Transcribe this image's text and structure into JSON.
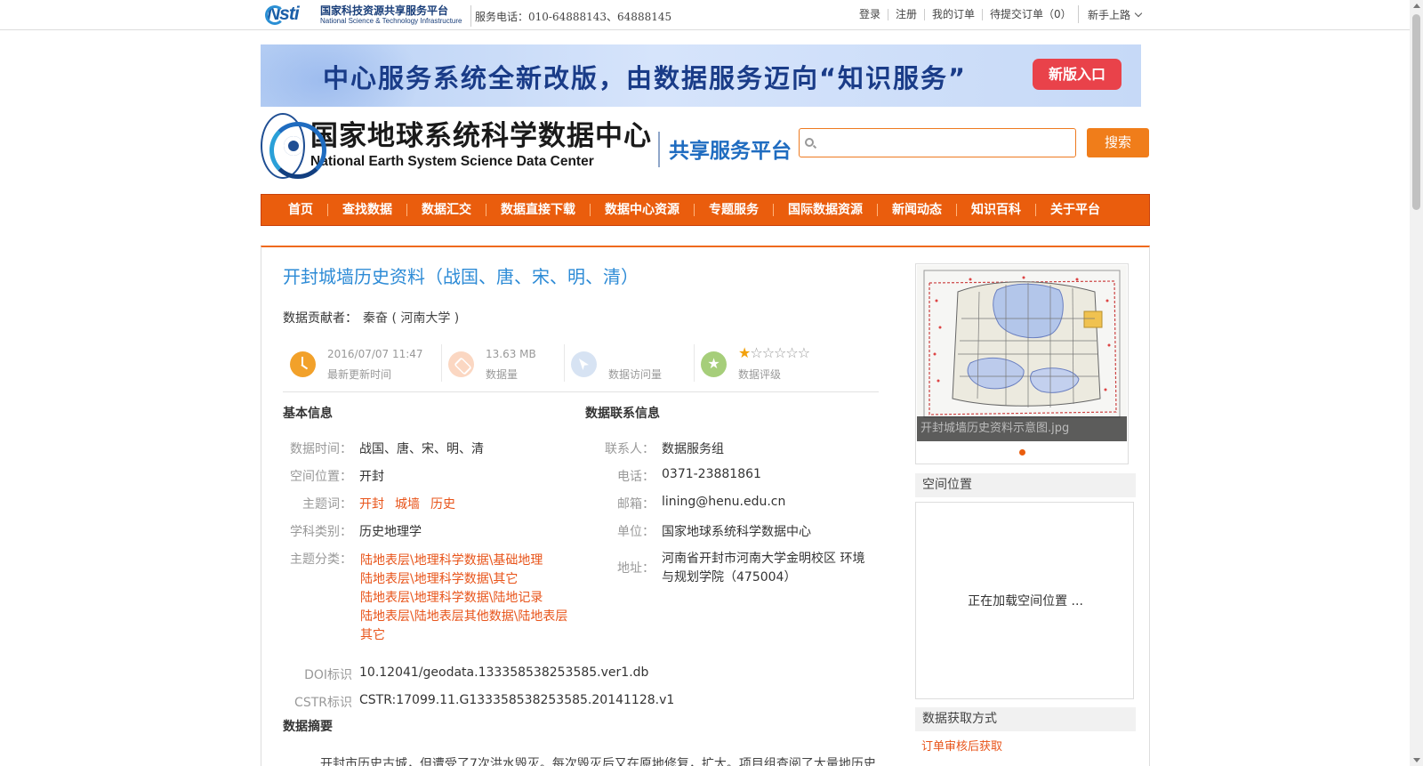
{
  "topbar": {
    "logo_cn": "国家科技资源共享服务平台",
    "logo_en": "National Science & Technology Infrastructure",
    "logo_mark": "Nsti",
    "service_phone": "服务电话：010-64888143、64888145",
    "links": [
      "登录",
      "注册",
      "我的订单",
      "待提交订单（0）"
    ],
    "newbie": "新手上路"
  },
  "banner": {
    "text": "中心服务系统全新改版，由数据服务迈向“知识服务”",
    "button": "新版入口"
  },
  "header": {
    "center_cn": "国家地球系统科学数据中心",
    "center_en": "National Earth System Science Data Center",
    "platform": "共享服务平台",
    "search_placeholder": "",
    "search_button": "搜索"
  },
  "nav": [
    "首页",
    "查找数据",
    "数据汇交",
    "数据直接下载",
    "数据中心资源",
    "专题服务",
    "国际数据资源",
    "新闻动态",
    "知识百科",
    "关于平台"
  ],
  "dataset": {
    "title": "开封城墙历史资料（战国、唐、宋、明、清）",
    "contributor_label": "数据贡献者：",
    "contributor": "秦奋 ( 河南大学 )",
    "stats": {
      "updated_value": "2016/07/07 11:47",
      "updated_label": "最新更新时间",
      "size_value": "13.63 MB",
      "size_label": "数据量",
      "visits_label": "数据访问量",
      "rating_label": "数据评级",
      "rating": 1,
      "rating_max": 6
    },
    "basic": {
      "heading": "基本信息",
      "time_label": "数据时间：",
      "time": "战国、唐、宋、明、清",
      "space_label": "空间位置：",
      "space": "开封",
      "keywords_label": "主题词：",
      "keywords": [
        "开封",
        "城墙",
        "历史"
      ],
      "discipline_label": "学科类别：",
      "discipline": "历史地理学",
      "category_label": "主题分类：",
      "categories": [
        "陆地表层\\地理科学数据\\基础地理",
        "陆地表层\\地理科学数据\\其它",
        "陆地表层\\地理科学数据\\陆地记录",
        "陆地表层\\陆地表层其他数据\\陆地表层其它"
      ],
      "doi_label": "DOI标识",
      "doi": "10.12041/geodata.133358538253585.ver1.db",
      "cstr_label": "CSTR标识",
      "cstr": "CSTR:17099.11.G133358538253585.20141128.v1"
    },
    "contact": {
      "heading": "数据联系信息",
      "person_label": "联系人：",
      "person": "数据服务组",
      "phone_label": "电话：",
      "phone": "0371-23881861",
      "email_label": "邮箱：",
      "email": "lining@henu.edu.cn",
      "org_label": "单位：",
      "org": "国家地球系统科学数据中心",
      "address_label": "地址：",
      "address_line1": "河南省开封市河南大学金明校区 环境",
      "address_line2": "与规划学院（475004）"
    },
    "abstract_heading": "数据摘要",
    "abstract": "开封市历史古城，但遭受了7次洪水毁灭。每次毁灭后又在原地修复，扩大。项目组查阅了大量地历史"
  },
  "side": {
    "thumb_caption": "开封城墙历史资料示意图.jpg",
    "spatial_heading": "空间位置",
    "spatial_loading": "正在加载空间位置 ...",
    "access_heading": "数据获取方式",
    "access_method": "订单审核后获取"
  },
  "colors": {
    "accent": "#ea5d0d",
    "link": "#e8541a",
    "title_blue": "#2d8bd6"
  }
}
